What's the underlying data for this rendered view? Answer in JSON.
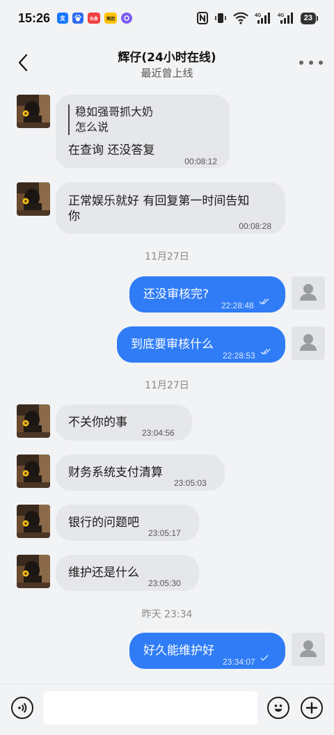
{
  "status_bar": {
    "time": "15:26",
    "apps": [
      {
        "icon": "alipay-icon",
        "text": "支",
        "color": "#1677ff"
      },
      {
        "icon": "baidu-icon",
        "text": "",
        "color": "#2f6cf0"
      },
      {
        "icon": "toutiao-icon",
        "text": "头条",
        "color": "#f04142"
      },
      {
        "icon": "meituan-icon",
        "text": "美团",
        "color": "#ffc300"
      },
      {
        "icon": "app-icon",
        "text": "",
        "color": "#7b5cf0"
      }
    ],
    "battery": "23"
  },
  "header": {
    "title": "辉仔(24小时在线)",
    "subtitle": "最近曾上线"
  },
  "messages": {
    "m1": {
      "quote_line1": "稳如强哥抓大奶",
      "quote_line2": "怎么说",
      "text": "在查询 还没答复",
      "time": "00:08:12"
    },
    "m2": {
      "line1": "正常娱乐就好  有回复第一时间告知",
      "line2": "你",
      "time": "00:08:28"
    },
    "sep1": "11月27日",
    "m3": {
      "text": "还没审核完?",
      "time": "22:28:48"
    },
    "m4": {
      "text": "到底要审核什么",
      "time": "22:28:53"
    },
    "sep2": "11月27日",
    "m5": {
      "text": "不关你的事",
      "time": "23:04:56"
    },
    "m6": {
      "text": "财务系统支付清算",
      "time": "23:05:03"
    },
    "m7": {
      "text": "银行的问题吧",
      "time": "23:05:17"
    },
    "m8": {
      "text": "维护还是什么",
      "time": "23:05:30"
    },
    "sep3": "昨天 23:34",
    "m9": {
      "text": "好久能维护好",
      "time": "23:34:07"
    }
  },
  "input_bar": {
    "placeholder": ""
  },
  "colors": {
    "outgoing_bubble": "#2f7cf6",
    "incoming_bubble": "#e6e7ea",
    "background": "#f2f3f5"
  }
}
